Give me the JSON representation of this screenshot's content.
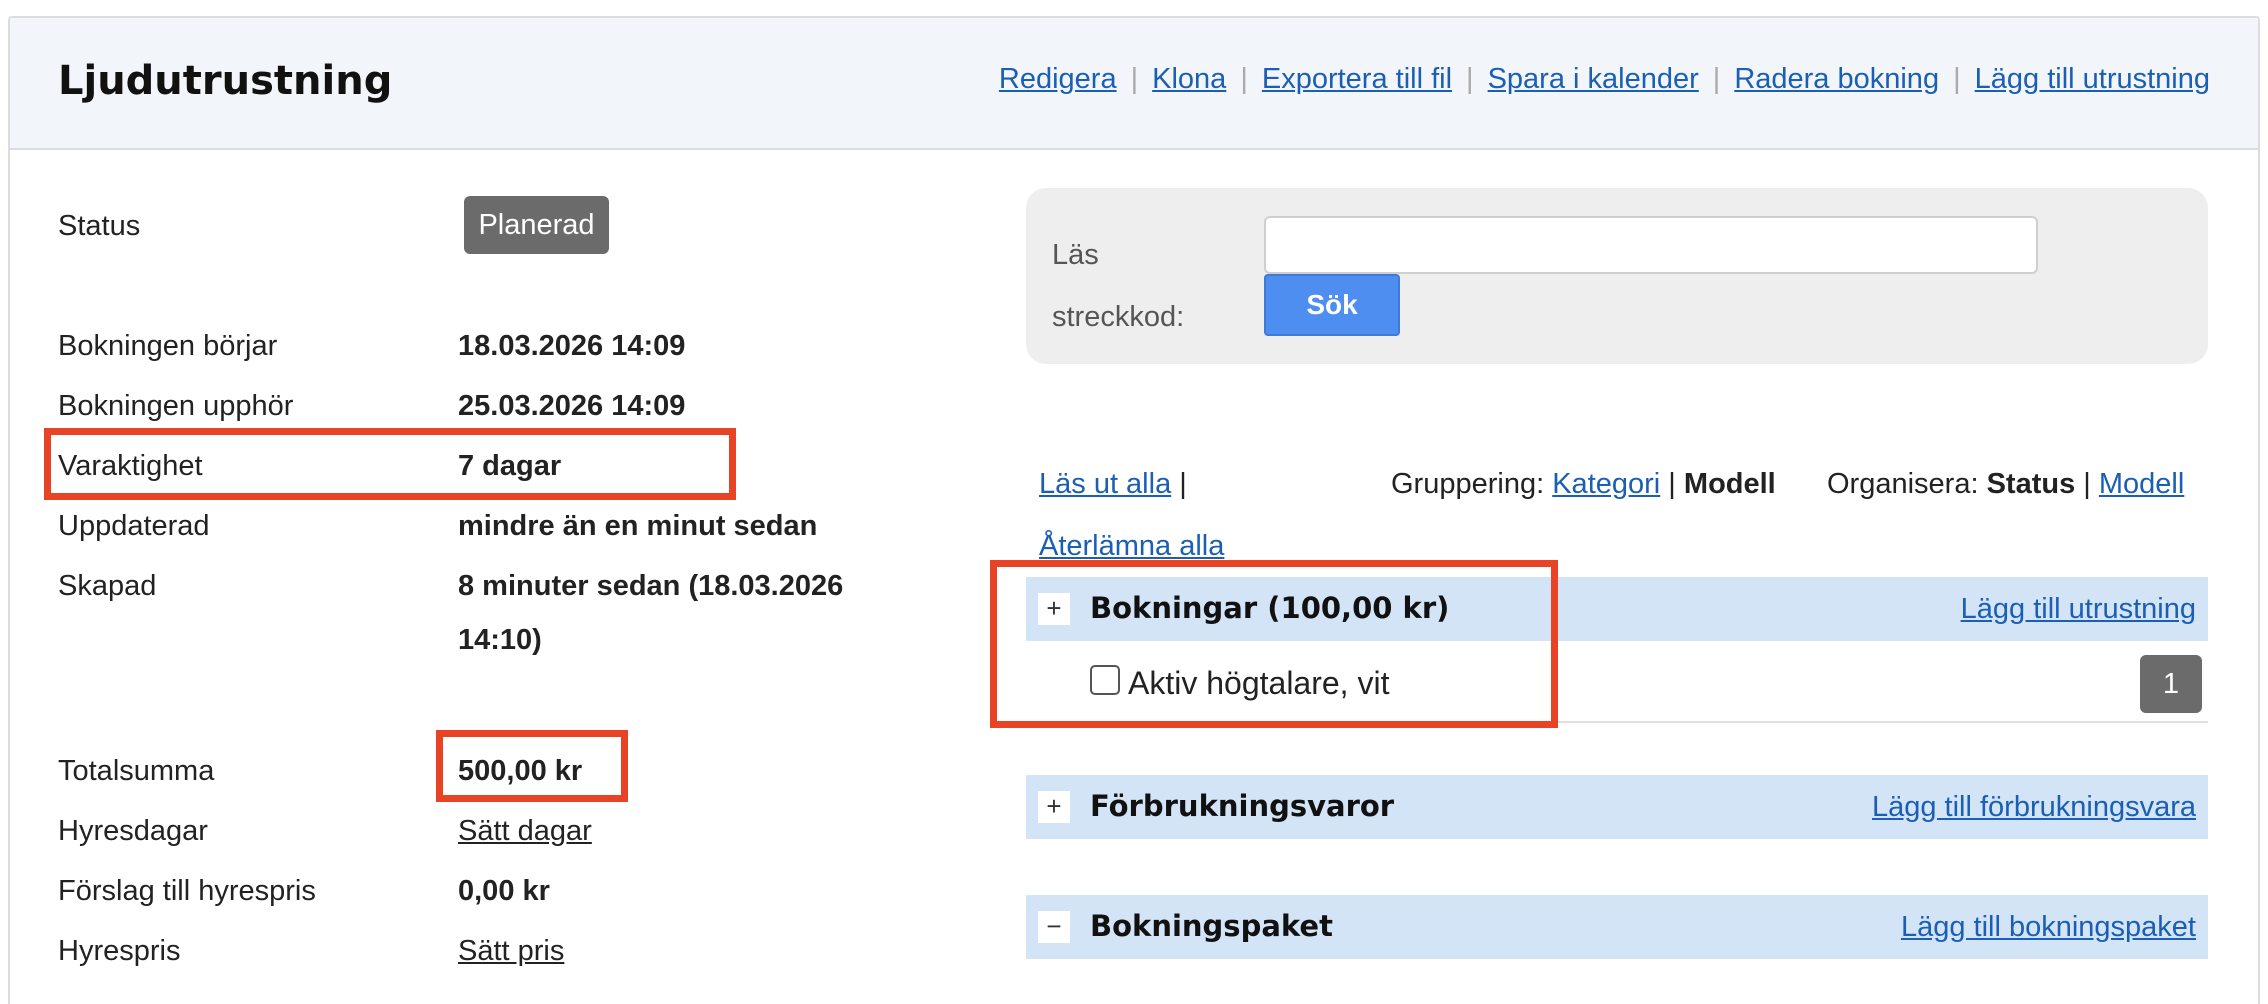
{
  "header": {
    "title": "Ljudutrustning",
    "actions": [
      "Redigera",
      "Klona",
      "Exportera till fil",
      "Spara i kalender",
      "Radera bokning",
      "Lägg till utrustning"
    ]
  },
  "details": {
    "status_label": "Status",
    "status_value": "Planerad",
    "start_label": "Bokningen börjar",
    "start_value": "18.03.2026 14:09",
    "end_label": "Bokningen upphör",
    "end_value": "25.03.2026 14:09",
    "duration_label": "Varaktighet",
    "duration_value": "7 dagar",
    "updated_label": "Uppdaterad",
    "updated_value": "mindre än en minut sedan",
    "created_label": "Skapad",
    "created_value_line1": "8 minuter sedan (18.03.2026",
    "created_value_line2": "14:10)",
    "total_label": "Totalsumma",
    "total_value": "500,00 kr",
    "rent_days_label": "Hyresdagar",
    "rent_days_link": "Sätt dagar",
    "suggested_price_label": "Förslag till hyrespris",
    "suggested_price_value": "0,00 kr",
    "rent_price_label": "Hyrespris",
    "rent_price_link": "Sätt pris"
  },
  "scanner": {
    "label_line1": "Läs",
    "label_line2": "streckkod:",
    "input_value": "",
    "search_button": "Sök"
  },
  "controls": {
    "checkout_all": "Läs ut alla",
    "return_all": "Återlämna alla",
    "grouping_label": "Gruppering:",
    "grouping_category": "Kategori",
    "grouping_model": "Modell",
    "organize_label": "Organisera:",
    "organize_status": "Status",
    "organize_model": "Modell",
    "separator": "|"
  },
  "sections": {
    "bookings_title": "Bokningar (100,00 kr)",
    "bookings_link": "Lägg till utrustning",
    "consumables_title": "Förbrukningsvaror",
    "consumables_link": "Lägg till förbrukningsvara",
    "packages_title": "Bokningspaket",
    "packages_link": "Lägg till bokningspaket",
    "plus": "+",
    "minus": "−"
  },
  "booking_items": [
    {
      "label": "Aktiv högtalare, vit",
      "quantity": "1"
    }
  ],
  "colors": {
    "link": "#1a5fb4",
    "highlight": "#e84325",
    "section_bg": "#d4e4f7",
    "badge_bg": "#6b6b6b",
    "button_bg": "#4f8ef1"
  }
}
